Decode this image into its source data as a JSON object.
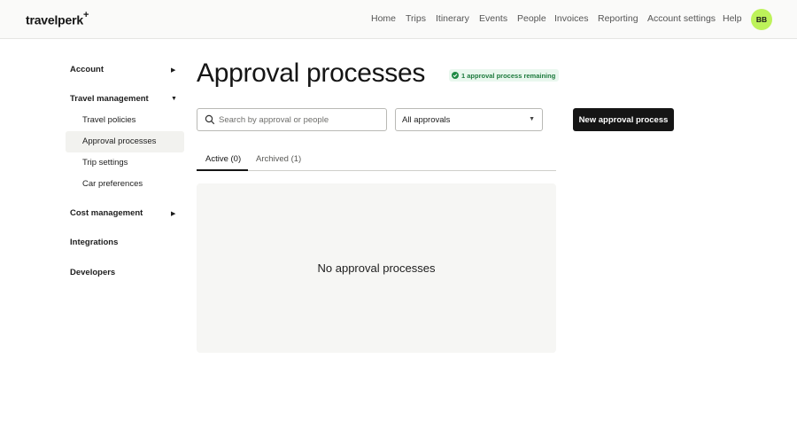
{
  "header": {
    "logo": "travelperk",
    "logo_mark": "+",
    "nav": [
      {
        "label": "Home"
      },
      {
        "label": "Trips"
      },
      {
        "label": "Itinerary"
      },
      {
        "label": "Events"
      },
      {
        "label": "People"
      },
      {
        "label": "Invoices"
      },
      {
        "label": "Reporting"
      },
      {
        "label": "Account settings"
      },
      {
        "label": "Help"
      }
    ],
    "avatar_initials": "BB",
    "avatar_color": "#bdf25a"
  },
  "sidebar": {
    "sections": [
      {
        "label": "Account",
        "arrow": "▶"
      },
      {
        "label": "Travel management",
        "arrow": "▼",
        "items": [
          {
            "label": "Travel policies"
          },
          {
            "label": "Approval processes",
            "active": true
          },
          {
            "label": "Trip settings"
          },
          {
            "label": "Car preferences"
          }
        ]
      },
      {
        "label": "Cost management",
        "arrow": "▶"
      },
      {
        "label": "Integrations"
      },
      {
        "label": "Developers"
      }
    ]
  },
  "main": {
    "title": "Approval processes",
    "badge": {
      "text": "1 approval process remaining",
      "icon": "check-circle-icon",
      "color": "#1d7a3d"
    },
    "search": {
      "placeholder": "Search by approval or people",
      "value": ""
    },
    "filter": {
      "selected": "All approvals",
      "icon": "caret-down-icon"
    },
    "new_button": "New approval process",
    "tabs": [
      {
        "label": "Active (0)",
        "active": true
      },
      {
        "label": "Archived (1)",
        "active": false
      }
    ],
    "empty_state": "No approval processes"
  }
}
